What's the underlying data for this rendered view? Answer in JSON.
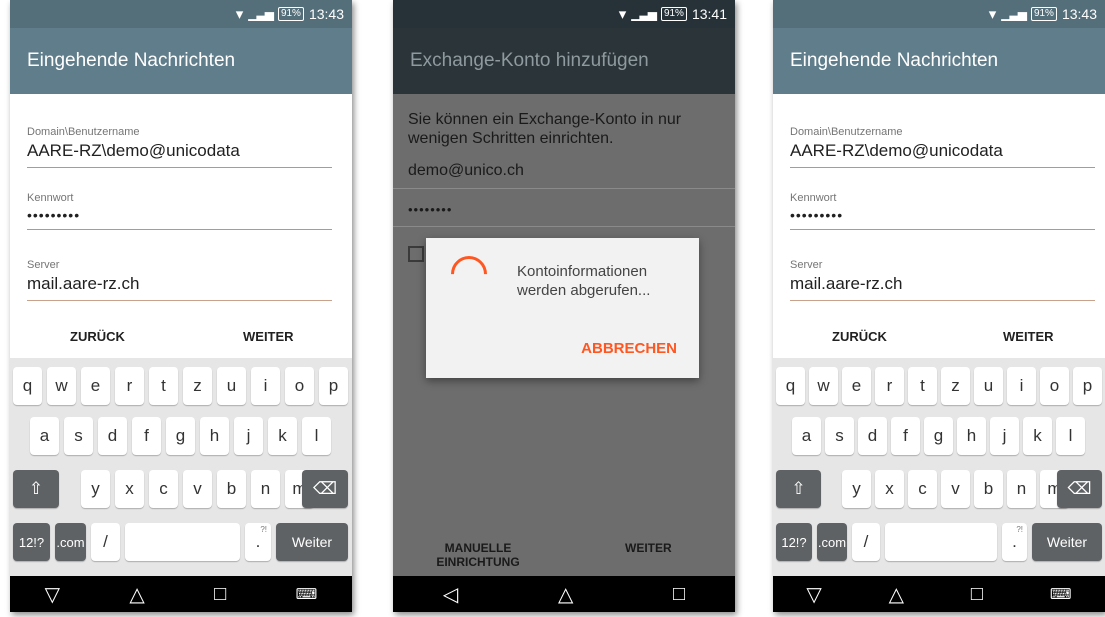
{
  "status": {
    "battery": "91%",
    "time_left": "13:43",
    "time_middle": "13:41",
    "time_right": "13:43"
  },
  "screen1": {
    "title": "Eingehende Nachrichten",
    "username_label": "Domain\\Benutzername",
    "username_value": "AARE-RZ\\demo@unicodata",
    "password_label": "Kennwort",
    "password_value": "•••••••••",
    "server_label": "Server",
    "server_value": "mail.aare-rz.ch",
    "back_label": "ZURÜCK",
    "next_label": "WEITER"
  },
  "screen2": {
    "title": "Exchange-Konto hinzufügen",
    "intro": "Sie können ein Exchange-Konto in nur wenigen Schritten einrichten.",
    "email": "demo@unico.ch",
    "password": "••••••••",
    "dialog_text": "Kontoinformationen werden abgerufen...",
    "dialog_cancel": "ABBRECHEN",
    "manual_label": "MANUELLE EINRICHTUNG",
    "next_label": "WEITER"
  },
  "keyboard": {
    "row1": [
      "q",
      "w",
      "e",
      "r",
      "t",
      "z",
      "u",
      "i",
      "o",
      "p"
    ],
    "row2": [
      "a",
      "s",
      "d",
      "f",
      "g",
      "h",
      "j",
      "k",
      "l"
    ],
    "row3": [
      "y",
      "x",
      "c",
      "v",
      "b",
      "n",
      "m"
    ],
    "shift": "⇧",
    "backspace": "⌫",
    "symbols": "12!?",
    "dotcom": ".com",
    "slash": "/",
    "period": ".",
    "period_sup": "?!",
    "enter": "Weiter"
  },
  "nav": {
    "back": "▽",
    "back_alt": "◁",
    "home": "△",
    "recents": "□",
    "keyboard": "⌨"
  },
  "icons": {
    "wifi": "wifi-icon",
    "signal": "signal-icon",
    "battery": "battery-icon"
  },
  "colors": {
    "toolbar": "#607d8b",
    "accent": "#ff5722"
  }
}
